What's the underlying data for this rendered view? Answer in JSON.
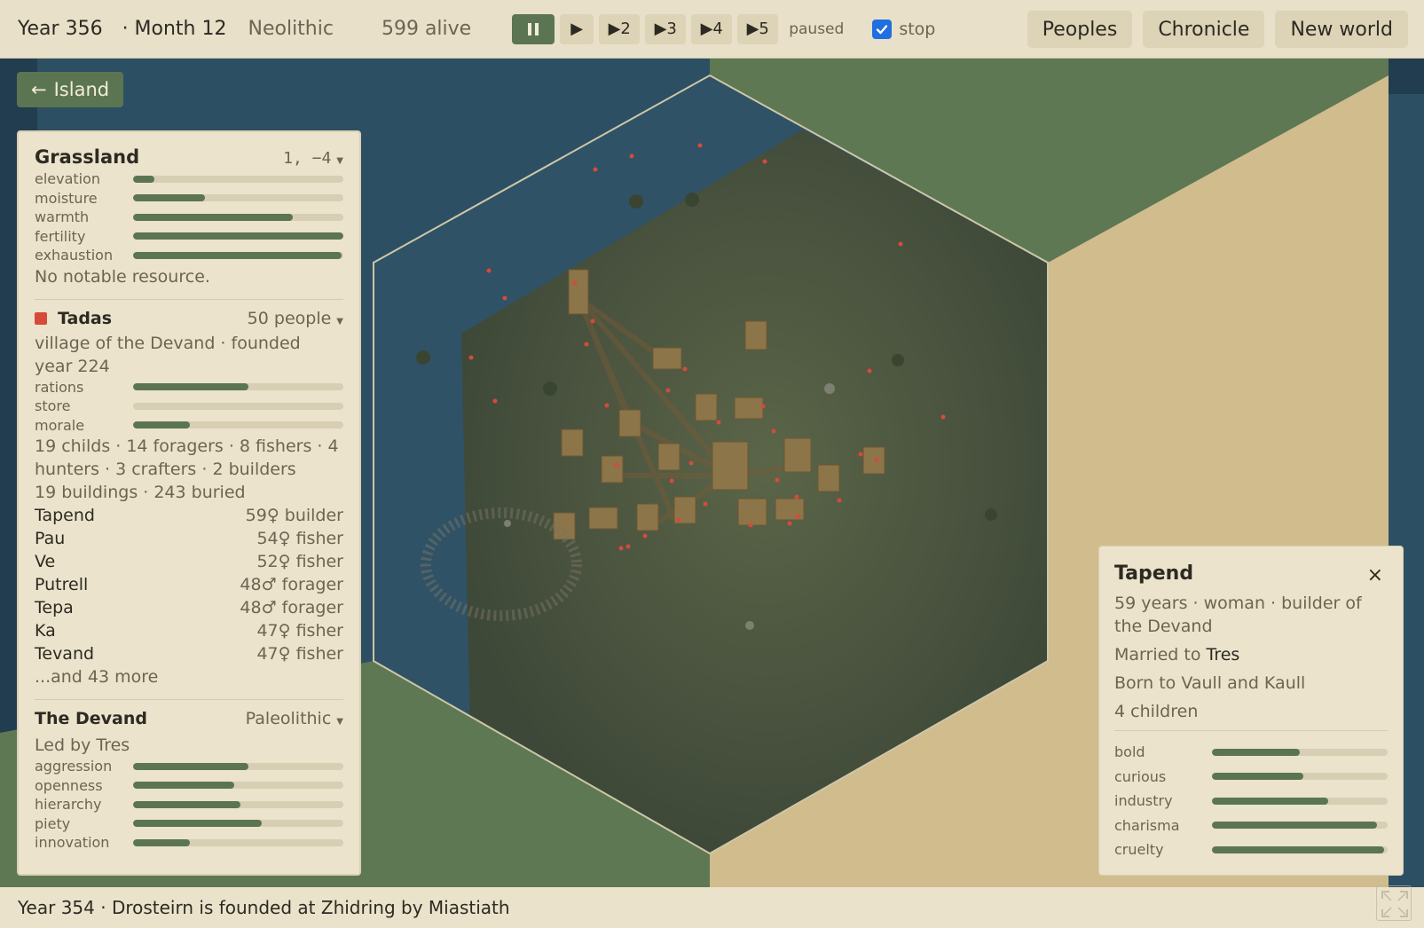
{
  "topbar": {
    "year": "Year 356",
    "month": "· Month 12",
    "era": "Neolithic",
    "alive": "599 alive",
    "speeds": [
      "▶",
      "▶2",
      "▶3",
      "▶4",
      "▶5"
    ],
    "status": "paused",
    "stop_label": "stop",
    "stop_checked": true,
    "nav": [
      "Peoples",
      "Chronicle",
      "New world"
    ]
  },
  "map": {
    "back_label": "Island",
    "colors": {
      "ocean": "#2c4f63",
      "forest": "#5d7852",
      "sand": "#d1bc8d",
      "hex_inner": "#424c3a",
      "building": "#8c7548",
      "accent_dots": "#d64a3a"
    }
  },
  "tile": {
    "title": "Grassland",
    "coords": "1, −4",
    "stats": [
      {
        "label": "elevation",
        "value": 0.1
      },
      {
        "label": "moisture",
        "value": 0.34
      },
      {
        "label": "warmth",
        "value": 0.76
      },
      {
        "label": "fertility",
        "value": 1.0
      },
      {
        "label": "exhaustion",
        "value": 0.99
      }
    ],
    "resource": "No notable resource."
  },
  "settlement": {
    "name": "Tadas",
    "people": "50 people",
    "desc": "village of the Devand · founded year 224",
    "stats": [
      {
        "label": "rations",
        "value": 0.55
      },
      {
        "label": "store",
        "value": 0.0
      },
      {
        "label": "morale",
        "value": 0.27
      }
    ],
    "roles": "19 childs · 14 foragers · 8 fishers · 4 hunters · 3 crafters · 2 builders",
    "buildings": "19 buildings · 243 buried",
    "people_list": [
      {
        "name": "Tapend",
        "detail": "59♀ builder"
      },
      {
        "name": "Pau",
        "detail": "54♀ fisher"
      },
      {
        "name": "Ve",
        "detail": "52♀ fisher"
      },
      {
        "name": "Putrell",
        "detail": "48♂ forager"
      },
      {
        "name": "Tepa",
        "detail": "48♂ forager"
      },
      {
        "name": "Ka",
        "detail": "47♀ fisher"
      },
      {
        "name": "Tevand",
        "detail": "47♀ fisher"
      }
    ],
    "more": "...and 43 more"
  },
  "culture": {
    "name": "The Devand",
    "era": "Paleolithic",
    "leader": "Led by Tres",
    "stats": [
      {
        "label": "aggression",
        "value": 0.55
      },
      {
        "label": "openness",
        "value": 0.48
      },
      {
        "label": "hierarchy",
        "value": 0.51
      },
      {
        "label": "piety",
        "value": 0.61
      },
      {
        "label": "innovation",
        "value": 0.27
      }
    ]
  },
  "person": {
    "name": "Tapend",
    "close": "×",
    "desc": "59 years · woman · builder of the Devand",
    "married_prefix": "Married to",
    "spouse": "Tres",
    "born": "Born to Vaull and Kaull",
    "children": "4 children",
    "traits": [
      {
        "label": "bold",
        "value": 0.5
      },
      {
        "label": "curious",
        "value": 0.52
      },
      {
        "label": "industry",
        "value": 0.66
      },
      {
        "label": "charisma",
        "value": 0.94
      },
      {
        "label": "cruelty",
        "value": 0.98
      }
    ]
  },
  "status_bar": {
    "message": "Year 354 · Drosteirn is founded at Zhidring by Miastiath"
  }
}
